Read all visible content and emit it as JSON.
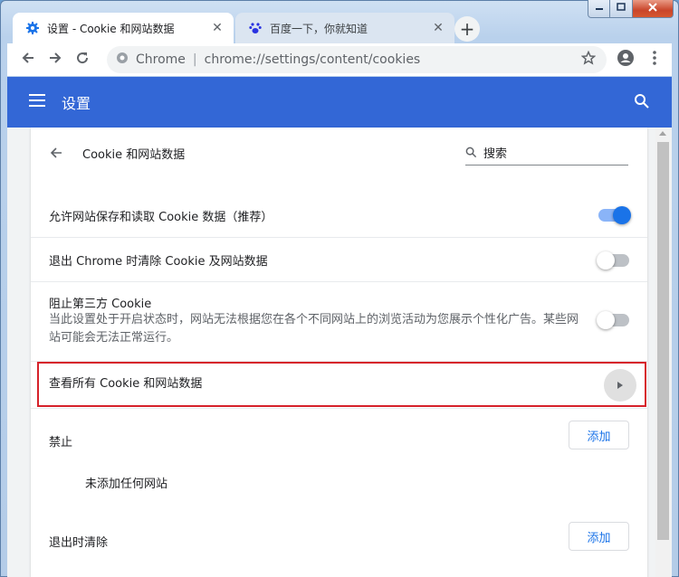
{
  "window": {
    "minimize_icon": "minimize-icon",
    "maximize_icon": "maximize-icon",
    "close_icon": "close-icon"
  },
  "tabs": [
    {
      "title": "设置 - Cookie 和网站数据",
      "icon": "gear-icon",
      "active": true
    },
    {
      "title": "百度一下，你就知道",
      "icon": "baidu-paw-icon",
      "active": false
    }
  ],
  "toolbar": {
    "site_chip": "Chrome",
    "separator": "|",
    "url": "chrome://settings/content/cookies"
  },
  "header": {
    "title": "设置"
  },
  "page": {
    "title": "Cookie 和网站数据",
    "search_placeholder": "搜索"
  },
  "settings": {
    "allow_label": "允许网站保存和读取 Cookie 数据（推荐）",
    "allow_on": true,
    "clear_on_exit_label": "退出 Chrome 时清除 Cookie 及网站数据",
    "clear_on_exit_on": false,
    "block_third_party_label": "阻止第三方 Cookie",
    "block_third_party_desc": "当此设置处于开启状态时，网站无法根据您在各个不同网站上的浏览活动为您展示个性化广告。某些网站可能会无法正常运行。",
    "block_third_party_on": false,
    "see_all_label": "查看所有 Cookie 和网站数据"
  },
  "block_section": {
    "label": "禁止",
    "add_label": "添加",
    "empty_text": "未添加任何网站"
  },
  "clear_section": {
    "label": "退出时清除",
    "add_label": "添加"
  },
  "colors": {
    "header_blue": "#3367d6",
    "toggle_on": "#1a73e8",
    "highlight_red": "#d6212a"
  }
}
